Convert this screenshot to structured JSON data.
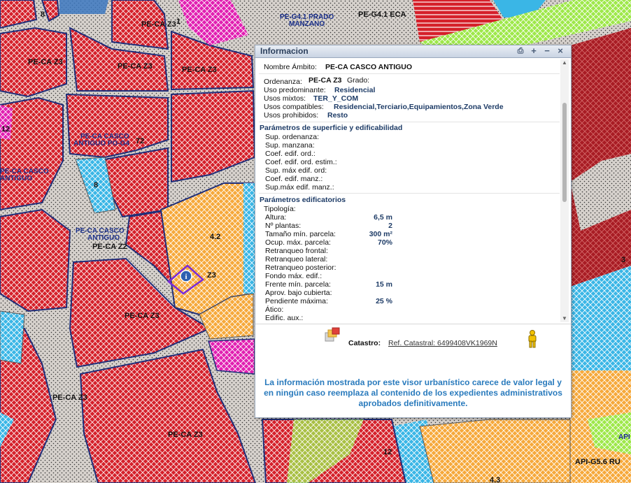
{
  "map": {
    "labels": [
      "PE-CA Z3",
      "PE-CA Z3",
      "PE-CA Z3",
      "PE-CA Z3",
      "PE-CA Z3",
      "PE-CA Z3",
      "PE-CA Z3",
      "PE-CA Z2",
      "PE-G4.1 ECA",
      "PE-G4.1 PRADO",
      "MANZANO",
      "PE-CA CASCO",
      "ANTIGUO PO-G4",
      "PE-CA CASCO",
      "ANTIGUO",
      "PE-CA CASCO",
      "ANTIGUO",
      "8",
      "8",
      "12",
      "4.2",
      "72",
      "12",
      "3",
      "4.3",
      "API-G5.6 RU",
      "API",
      "Z3",
      "1"
    ]
  },
  "popup": {
    "title": "Informacion",
    "header_buttons": {
      "print": "⎙",
      "maximize": "+",
      "minimize": "−",
      "close": "×"
    },
    "ambito_label": "Nombre Ámbito:",
    "ambito_value": "PE-CA CASCO ANTIGUO",
    "ordenanza_label": "Ordenanza:",
    "ordenanza_value": "PE-CA Z3",
    "grado_label": "Grado:",
    "uso_pred_label": "Uso predominante:",
    "uso_pred_value": "Residencial",
    "usos_mixtos_label": "Usos mixtos:",
    "usos_mixtos_value": "TER_Y_COM",
    "usos_compat_label": "Usos compatibles:",
    "usos_compat_value": "Residencial,Terciario,Equipamientos,Zona Verde",
    "usos_prohib_label": "Usos prohibidos:",
    "usos_prohib_value": "Resto",
    "sec_superficie": "Parámetros de superficie y edificabilidad",
    "superficie_rows": [
      "Sup. ordenanza:",
      "Sup. manzana:",
      "Coef. edif. ord.:",
      "Coef. edif. ord. estim.:",
      "Sup. máx edif. ord:",
      "Coef. edif. manz.:",
      "Sup.máx edif. manz.:"
    ],
    "sec_edificatorios": "Parámetros edificatorios",
    "edif_rows": [
      {
        "label": "Tipología:",
        "value": ""
      },
      {
        "label": "Altura:",
        "value": "6,5 m"
      },
      {
        "label": "Nº plantas:",
        "value": "2"
      },
      {
        "label": "Tamaño mín. parcela:",
        "value": "300 m²"
      },
      {
        "label": "Ocup. máx. parcela:",
        "value": "70%"
      },
      {
        "label": "Retranqueo frontal:",
        "value": ""
      },
      {
        "label": "Retranqueo lateral:",
        "value": ""
      },
      {
        "label": "Retranqueo posterior:",
        "value": ""
      },
      {
        "label": "Fondo máx. edif.:",
        "value": ""
      },
      {
        "label": "Frente mín. parcela:",
        "value": "15 m"
      },
      {
        "label": "Aprov. bajo cubierta:",
        "value": ""
      },
      {
        "label": "Pendiente máxima:",
        "value": "25 %"
      },
      {
        "label": "Ático:",
        "value": ""
      },
      {
        "label": "Edific. aux.:",
        "value": ""
      }
    ],
    "catastro_label": "Catastro:",
    "catastro_link": "Ref. Catastral: 6499408VK1969N",
    "disclaimer": "La información mostrada por este visor urbanístico carece de valor legal y en ningún caso reemplaza al contenido de los expedientes administrativos aprobados definitivamente.",
    "icons": {
      "catastro": "layers-icon",
      "streetview": "pegman-icon",
      "info": "info-icon"
    }
  }
}
